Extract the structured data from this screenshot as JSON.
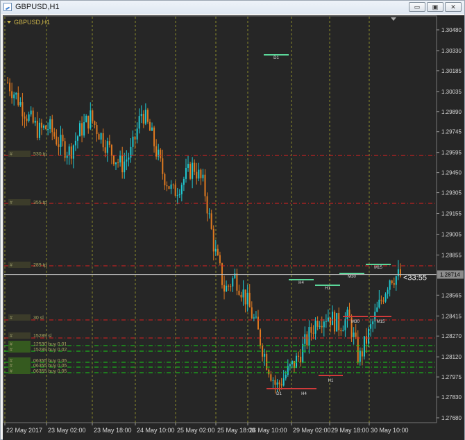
{
  "window": {
    "title": "GBPUSD,H1"
  },
  "controls": {
    "minimize": "▭",
    "restore": "▣",
    "close": "✕"
  },
  "chart": {
    "symbol_label": "GBPUSD,H1",
    "colors": {
      "background": "#262626",
      "grid": "#8a8a2a",
      "bull": "#20c8d0",
      "bear": "#e07a20",
      "axis_text": "#d8d8d8",
      "price_line": "#bdbdbd",
      "red_level": "#e02020",
      "green_level": "#18d018"
    },
    "price_axis": [
      "1.30480",
      "1.30330",
      "1.30185",
      "1.30035",
      "1.29890",
      "1.29745",
      "1.29595",
      "1.29450",
      "1.29305",
      "1.29155",
      "1.29005",
      "1.28855",
      "1.28565",
      "1.28415",
      "1.28270",
      "1.28120",
      "1.27975",
      "1.27830",
      "1.27680"
    ],
    "current_price": "1.28714",
    "countdown": "<33:55",
    "time_axis": [
      "22 May 2017",
      "23 May 02:00",
      "23 May 18:00",
      "24 May 10:00",
      "25 May 02:00",
      "25 May 18:00",
      "26 May 10:00",
      "29 May 02:00",
      "29 May 18:00",
      "30 May 10:00"
    ],
    "level_labels": [
      {
        "mark": "#",
        "text": "530 tp"
      },
      {
        "mark": "#",
        "text": "355 tp"
      },
      {
        "mark": "#",
        "text": "289 tp"
      },
      {
        "mark": "#",
        "text": "30 sl"
      },
      {
        "mark": "#",
        "text": "15289 sl"
      },
      {
        "mark": "#",
        "text": "12530 buy 0.01"
      },
      {
        "mark": "#",
        "text": "15289 buy 0.02"
      },
      {
        "mark": "#",
        "text": "06355 buy 0.05"
      },
      {
        "mark": "#",
        "text": "06355 buy 0.05"
      },
      {
        "mark": "#",
        "text": "06355 buy 0.05"
      }
    ],
    "tf_marks": [
      "D1",
      "H4",
      "H1",
      "M30",
      "M15",
      "M30",
      "M15",
      "H1",
      "D1",
      "H4"
    ]
  }
}
